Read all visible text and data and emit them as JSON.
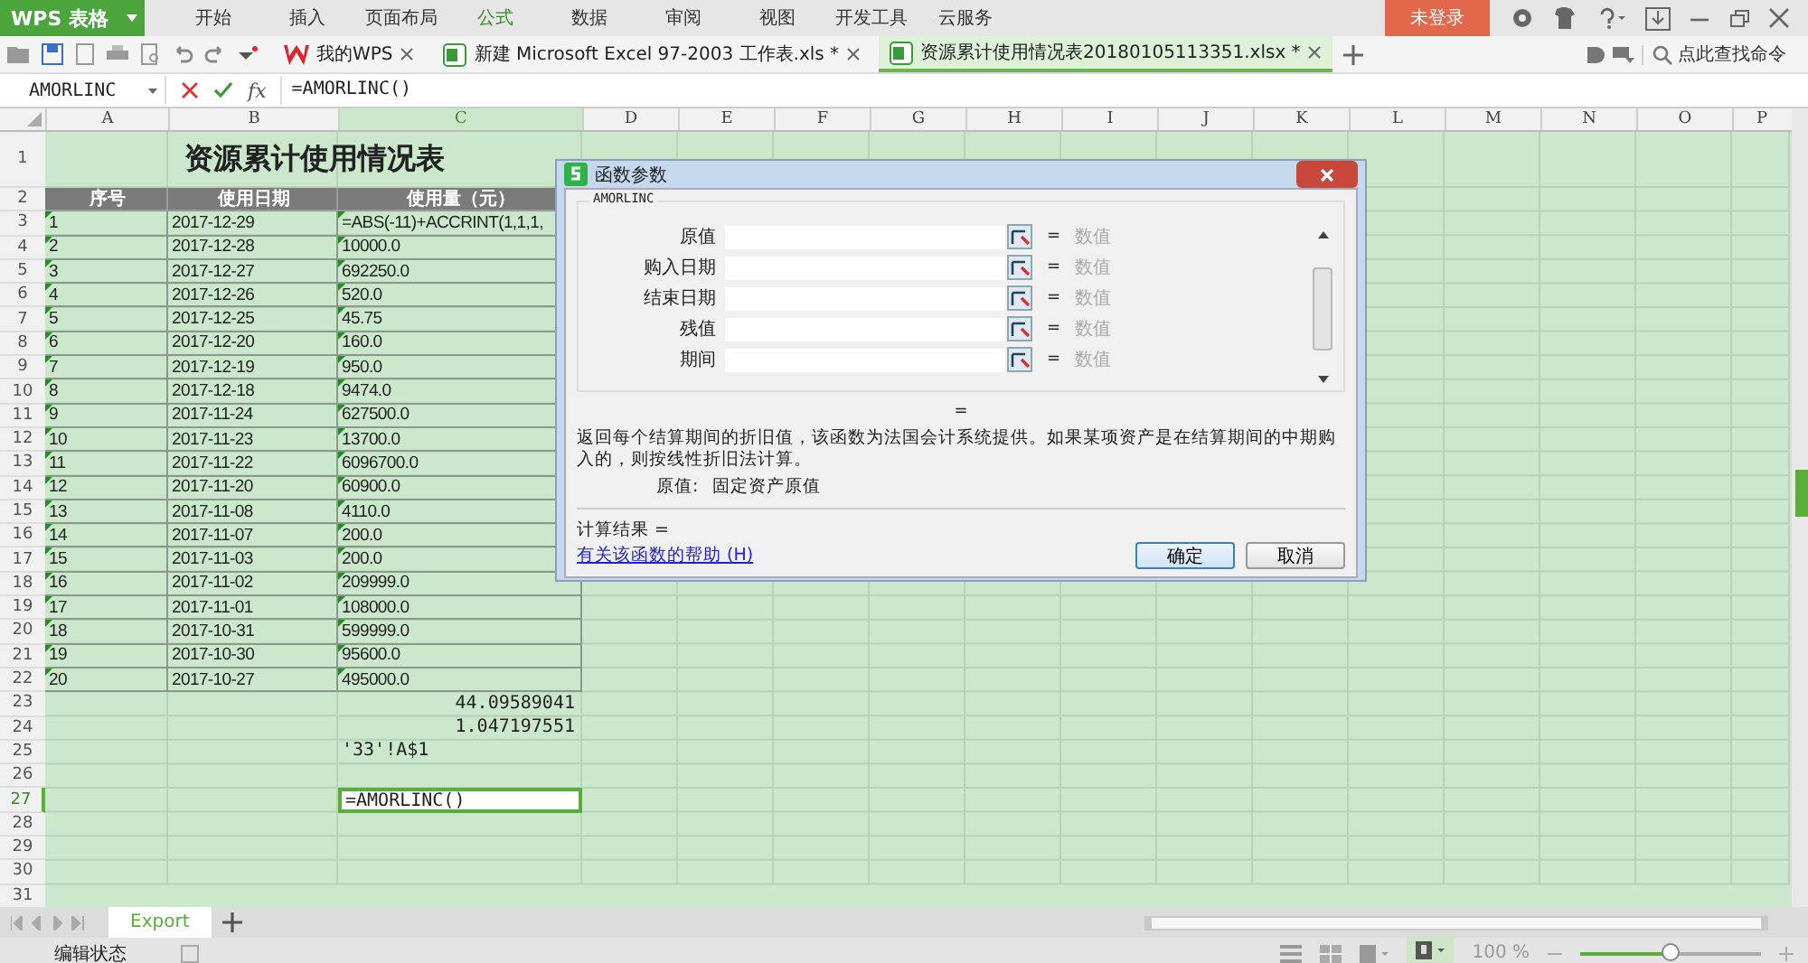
{
  "title_bar": {
    "app_button": "WPS 表格",
    "menu": [
      {
        "label": "开始",
        "selected": false
      },
      {
        "label": "插入",
        "selected": false
      },
      {
        "label": "页面布局",
        "selected": false
      },
      {
        "label": "公式",
        "selected": true
      },
      {
        "label": "数据",
        "selected": false
      },
      {
        "label": "审阅",
        "selected": false
      },
      {
        "label": "视图",
        "selected": false
      },
      {
        "label": "开发工具",
        "selected": false
      },
      {
        "label": "云服务",
        "selected": false
      }
    ],
    "login_button": "未登录"
  },
  "doc_tabs": [
    {
      "label": "我的WPS",
      "selected": false,
      "kind": "home"
    },
    {
      "label": "新建 Microsoft Excel 97-2003 工作表.xls *",
      "selected": false,
      "kind": "sheet"
    },
    {
      "label": "资源累计使用情况表20180105113351.xlsx *",
      "selected": true,
      "kind": "sheet"
    }
  ],
  "command_search": {
    "placeholder": "点此查找命令"
  },
  "formula_bar": {
    "name_box": "AMORLINC",
    "function_button": "fx",
    "formula": "=AMORLINC()"
  },
  "sheet": {
    "columns": [
      {
        "label": "A",
        "selected": false
      },
      {
        "label": "B",
        "selected": false
      },
      {
        "label": "C",
        "selected": true
      },
      {
        "label": "D",
        "selected": false
      },
      {
        "label": "E",
        "selected": false
      },
      {
        "label": "F",
        "selected": false
      },
      {
        "label": "G",
        "selected": false
      },
      {
        "label": "H",
        "selected": false
      },
      {
        "label": "I",
        "selected": false
      },
      {
        "label": "J",
        "selected": false
      },
      {
        "label": "K",
        "selected": false
      },
      {
        "label": "L",
        "selected": false
      },
      {
        "label": "M",
        "selected": false
      },
      {
        "label": "N",
        "selected": false
      },
      {
        "label": "O",
        "selected": false
      },
      {
        "label": "P",
        "selected": false
      }
    ],
    "rows": [
      {
        "label": "1",
        "selected": false,
        "kind": "title",
        "cells": [
          "",
          "资源累计使用情况表",
          ""
        ]
      },
      {
        "label": "2",
        "selected": false,
        "kind": "header",
        "cells": [
          "序号",
          "使用日期",
          "使用量（元）"
        ]
      },
      {
        "label": "3",
        "selected": false,
        "kind": "data",
        "cells": [
          "1",
          "2017-12-29",
          "=ABS(-11)+ACCRINT(1,1,1,"
        ]
      },
      {
        "label": "4",
        "selected": false,
        "kind": "data",
        "cells": [
          "2",
          "2017-12-28",
          "10000.0"
        ]
      },
      {
        "label": "5",
        "selected": false,
        "kind": "data",
        "cells": [
          "3",
          "2017-12-27",
          "692250.0"
        ]
      },
      {
        "label": "6",
        "selected": false,
        "kind": "data",
        "cells": [
          "4",
          "2017-12-26",
          "520.0"
        ]
      },
      {
        "label": "7",
        "selected": false,
        "kind": "data",
        "cells": [
          "5",
          "2017-12-25",
          "45.75"
        ]
      },
      {
        "label": "8",
        "selected": false,
        "kind": "data",
        "cells": [
          "6",
          "2017-12-20",
          "160.0"
        ]
      },
      {
        "label": "9",
        "selected": false,
        "kind": "data",
        "cells": [
          "7",
          "2017-12-19",
          "950.0"
        ]
      },
      {
        "label": "10",
        "selected": false,
        "kind": "data",
        "cells": [
          "8",
          "2017-12-18",
          "9474.0"
        ]
      },
      {
        "label": "11",
        "selected": false,
        "kind": "data",
        "cells": [
          "9",
          "2017-11-24",
          "627500.0"
        ]
      },
      {
        "label": "12",
        "selected": false,
        "kind": "data",
        "cells": [
          "10",
          "2017-11-23",
          "13700.0"
        ]
      },
      {
        "label": "13",
        "selected": false,
        "kind": "data",
        "cells": [
          "11",
          "2017-11-22",
          "6096700.0"
        ]
      },
      {
        "label": "14",
        "selected": false,
        "kind": "data",
        "cells": [
          "12",
          "2017-11-20",
          "60900.0"
        ]
      },
      {
        "label": "15",
        "selected": false,
        "kind": "data",
        "cells": [
          "13",
          "2017-11-08",
          "4110.0"
        ]
      },
      {
        "label": "16",
        "selected": false,
        "kind": "data",
        "cells": [
          "14",
          "2017-11-07",
          "200.0"
        ]
      },
      {
        "label": "17",
        "selected": false,
        "kind": "data",
        "cells": [
          "15",
          "2017-11-03",
          "200.0"
        ]
      },
      {
        "label": "18",
        "selected": false,
        "kind": "data",
        "cells": [
          "16",
          "2017-11-02",
          "209999.0"
        ]
      },
      {
        "label": "19",
        "selected": false,
        "kind": "data",
        "cells": [
          "17",
          "2017-11-01",
          "108000.0"
        ]
      },
      {
        "label": "20",
        "selected": false,
        "kind": "data",
        "cells": [
          "18",
          "2017-10-31",
          "599999.0"
        ]
      },
      {
        "label": "21",
        "selected": false,
        "kind": "data",
        "cells": [
          "19",
          "2017-10-30",
          "95600.0"
        ]
      },
      {
        "label": "22",
        "selected": false,
        "kind": "data",
        "cells": [
          "20",
          "2017-10-27",
          "495000.0"
        ]
      },
      {
        "label": "23",
        "selected": false,
        "kind": "number",
        "cells": [
          "",
          "",
          "44.09589041"
        ]
      },
      {
        "label": "24",
        "selected": false,
        "kind": "number",
        "cells": [
          "",
          "",
          "1.047197551"
        ]
      },
      {
        "label": "25",
        "selected": false,
        "kind": "text",
        "cells": [
          "",
          "",
          "'33'!A$1"
        ]
      },
      {
        "label": "26",
        "selected": false,
        "kind": "empty",
        "cells": []
      },
      {
        "label": "27",
        "selected": true,
        "kind": "editing",
        "cells": [
          "",
          "",
          "=AMORLINC()"
        ]
      },
      {
        "label": "28",
        "selected": false,
        "kind": "empty",
        "cells": []
      },
      {
        "label": "29",
        "selected": false,
        "kind": "empty",
        "cells": []
      },
      {
        "label": "30",
        "selected": false,
        "kind": "empty",
        "cells": []
      },
      {
        "label": "31",
        "selected": false,
        "kind": "empty",
        "cells": []
      }
    ]
  },
  "dialog": {
    "title": "函数参数",
    "function_name": "AMORLINC",
    "arguments": [
      {
        "label": "原值",
        "sign": "=",
        "hint": "数值"
      },
      {
        "label": "购入日期",
        "sign": "=",
        "hint": "数值"
      },
      {
        "label": "结束日期",
        "sign": "=",
        "hint": "数值"
      },
      {
        "label": "残值",
        "sign": "=",
        "hint": "数值"
      },
      {
        "label": "期间",
        "sign": "=",
        "hint": "数值"
      }
    ],
    "result_sign": "=",
    "description": "返回每个结算期间的折旧值，该函数为法国会计系统提供。如果某项资产是在结算期间的中期购入的，则按线性折旧法计算。",
    "argument_help": {
      "label": "原值:",
      "text": "固定资产原值"
    },
    "calc_result": "计算结果 =",
    "help_link": "有关该函数的帮助 (H)",
    "buttons": [
      {
        "label": "确定",
        "default": true
      },
      {
        "label": "取消",
        "default": false
      }
    ]
  },
  "sheet_tabs": [
    {
      "label": "Export",
      "selected": true
    }
  ],
  "status_bar": {
    "mode": "编辑状态",
    "zoom": "100 %",
    "zoom_slider": {
      "level": 0.5
    }
  }
}
